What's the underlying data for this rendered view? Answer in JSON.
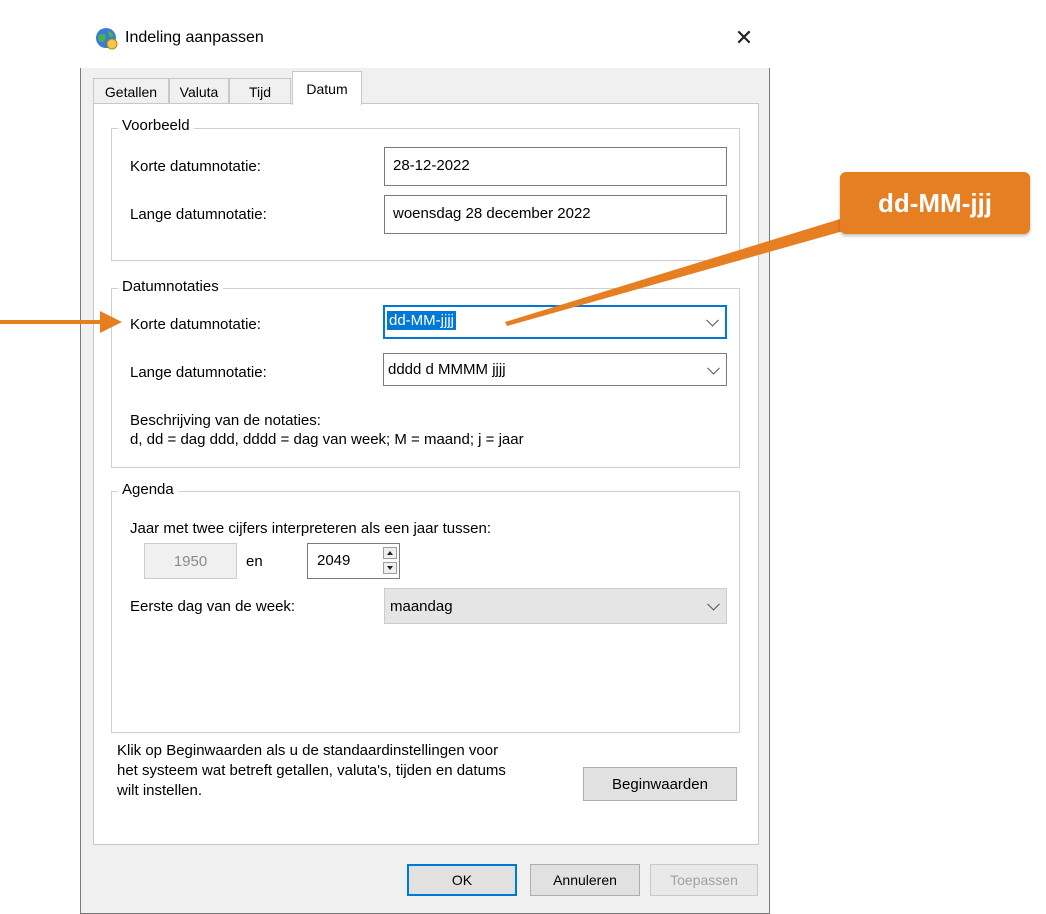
{
  "window": {
    "title": "Indeling aanpassen",
    "close_glyph": "✕"
  },
  "tabs": [
    {
      "label": "Getallen",
      "active": false
    },
    {
      "label": "Valuta",
      "active": false
    },
    {
      "label": "Tijd",
      "active": false
    },
    {
      "label": "Datum",
      "active": true
    }
  ],
  "voorbeeld": {
    "title": "Voorbeeld",
    "short_label": "Korte datumnotatie:",
    "short_value": "28-12-2022",
    "long_label": "Lange datumnotatie:",
    "long_value": "woensdag 28 december 2022"
  },
  "datumnotaties": {
    "title": "Datumnotaties",
    "short_label": "Korte datumnotatie:",
    "short_value": "dd-MM-jjjj",
    "long_label": "Lange datumnotatie:",
    "long_value": "dddd d MMMM jjjj",
    "desc_title": "Beschrijving van de notaties:",
    "desc_text": "d, dd = dag  ddd, dddd = dag van week;  M = maand;  j = jaar"
  },
  "agenda": {
    "title": "Agenda",
    "year_label": "Jaar met twee cijfers interpreteren als een jaar tussen:",
    "year_from": "1950",
    "en_label": "en",
    "year_to": "2049",
    "first_day_label": "Eerste dag van de week:",
    "first_day_value": "maandag"
  },
  "reset": {
    "text_line1": "Klik op Beginwaarden als u de standaardinstellingen voor",
    "text_line2": "het systeem wat betreft getallen, valuta's, tijden en datums",
    "text_line3": "wilt instellen.",
    "button_label": "Beginwaarden"
  },
  "footer": {
    "ok_label": "OK",
    "cancel_label": "Annuleren",
    "apply_label": "Toepassen"
  },
  "annotation": {
    "callout_text": "dd-MM-jjj",
    "accent_color": "#e67e22"
  },
  "colors": {
    "focus_blue": "#0078d7",
    "dialog_bg": "#f0f0f0"
  }
}
